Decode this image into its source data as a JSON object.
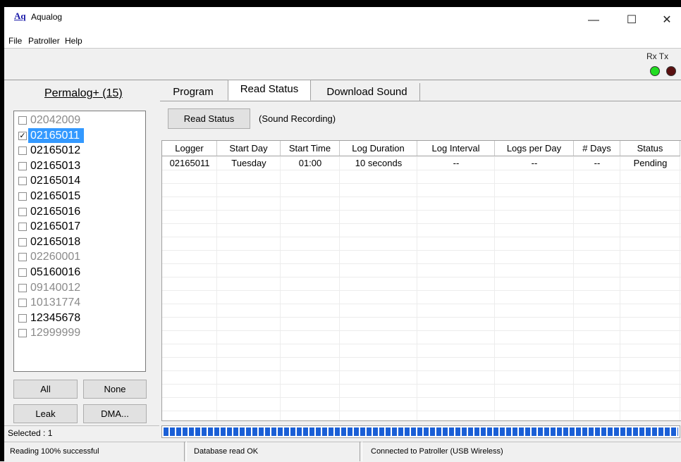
{
  "window": {
    "logo": "Aq",
    "title": "Aqualog",
    "controls": {
      "minimize": "—",
      "maximize": "☐",
      "close": "✕"
    }
  },
  "menu": [
    "File",
    "Patroller",
    "Help"
  ],
  "indicators": {
    "label": "Rx Tx",
    "rx_color": "#22dd22",
    "tx_color": "#5a1010"
  },
  "left_panel": {
    "title": "Permalog+ (15)",
    "loggers": [
      {
        "id": "02042009",
        "checked": false,
        "dim": true
      },
      {
        "id": "02165011",
        "checked": true,
        "selected": true
      },
      {
        "id": "02165012",
        "checked": false
      },
      {
        "id": "02165013",
        "checked": false
      },
      {
        "id": "02165014",
        "checked": false
      },
      {
        "id": "02165015",
        "checked": false
      },
      {
        "id": "02165016",
        "checked": false
      },
      {
        "id": "02165017",
        "checked": false
      },
      {
        "id": "02165018",
        "checked": false
      },
      {
        "id": "02260001",
        "checked": false,
        "dim": true
      },
      {
        "id": "05160016",
        "checked": false
      },
      {
        "id": "09140012",
        "checked": false,
        "dim": true
      },
      {
        "id": "10131774",
        "checked": false,
        "dim": true
      },
      {
        "id": "12345678",
        "checked": false
      },
      {
        "id": "12999999",
        "checked": false,
        "dim": true
      }
    ],
    "buttons": {
      "all": "All",
      "none": "None",
      "leak": "Leak",
      "dma": "DMA..."
    },
    "selected": "Selected : 1"
  },
  "tabs": [
    "Program",
    "Read Status",
    "Download Sound"
  ],
  "active_tab": "Read Status",
  "actions": {
    "read_status": "Read Status",
    "mode": "(Sound Recording)"
  },
  "table": {
    "columns": [
      "Logger",
      "Start Day",
      "Start Time",
      "Log Duration",
      "Log Interval",
      "Logs per Day",
      "# Days",
      "Status"
    ],
    "rows": [
      [
        "02165011",
        "Tuesday",
        "01:00",
        "10 seconds",
        "--",
        "--",
        "--",
        "Pending"
      ]
    ]
  },
  "progress": {
    "value": 1.0
  },
  "status_bar": [
    "Reading 100% successful",
    "Database read OK",
    "Connected to Patroller (USB Wireless)"
  ]
}
